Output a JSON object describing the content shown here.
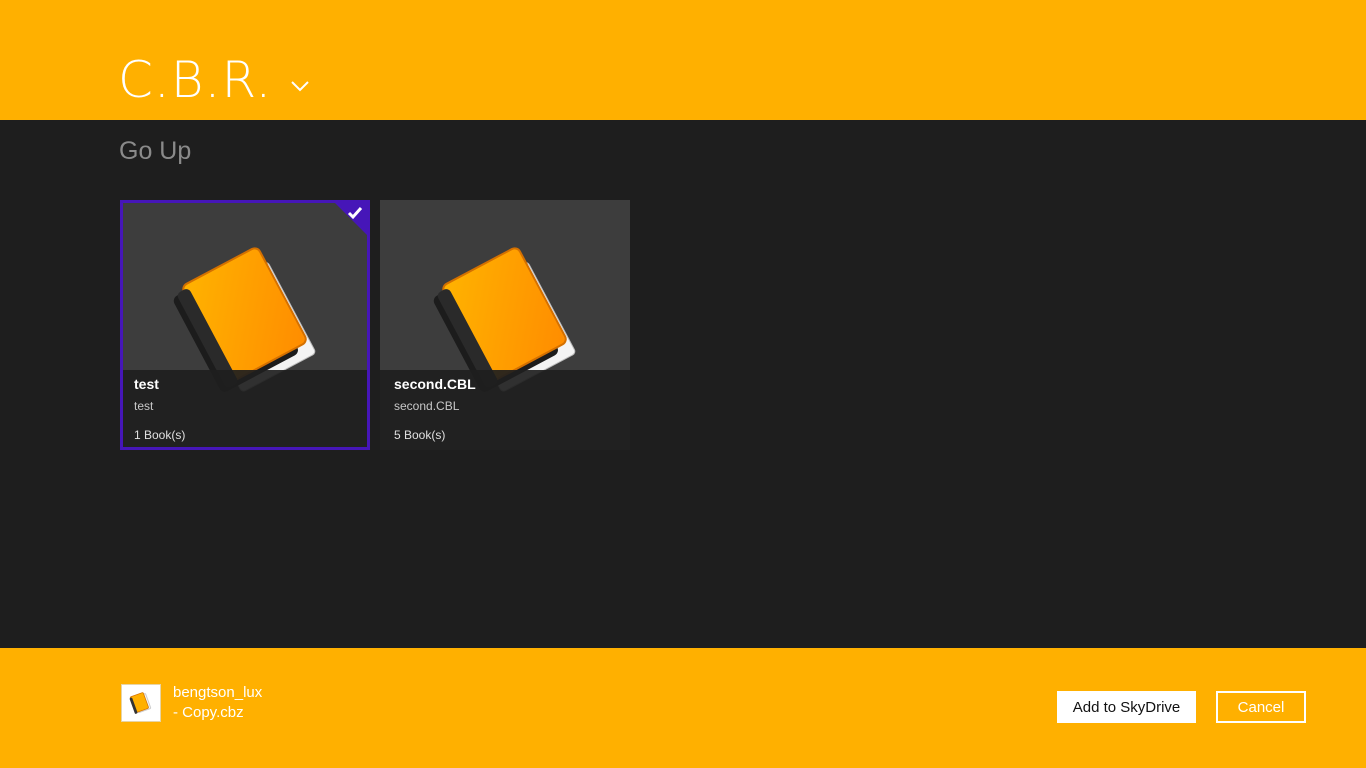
{
  "header": {
    "app_title": "C.B.R.",
    "accent_color": "#ffb000"
  },
  "navigation": {
    "go_up_label": "Go Up"
  },
  "tiles": [
    {
      "name": "test",
      "subtitle": "test",
      "count": "1 Book(s)",
      "selected": true,
      "icon": "orange-book-icon"
    },
    {
      "name": "second.CBL",
      "subtitle": "second.CBL",
      "count": "5 Book(s)",
      "selected": false,
      "icon": "orange-book-icon"
    }
  ],
  "selection_color": "#4616b8",
  "footer": {
    "file_icon": "book-thumbnail-icon",
    "file_name_line1": "bengtson_lux",
    "file_name_line2": "- Copy.cbz",
    "add_button_label": "Add to SkyDrive",
    "cancel_button_label": "Cancel"
  }
}
